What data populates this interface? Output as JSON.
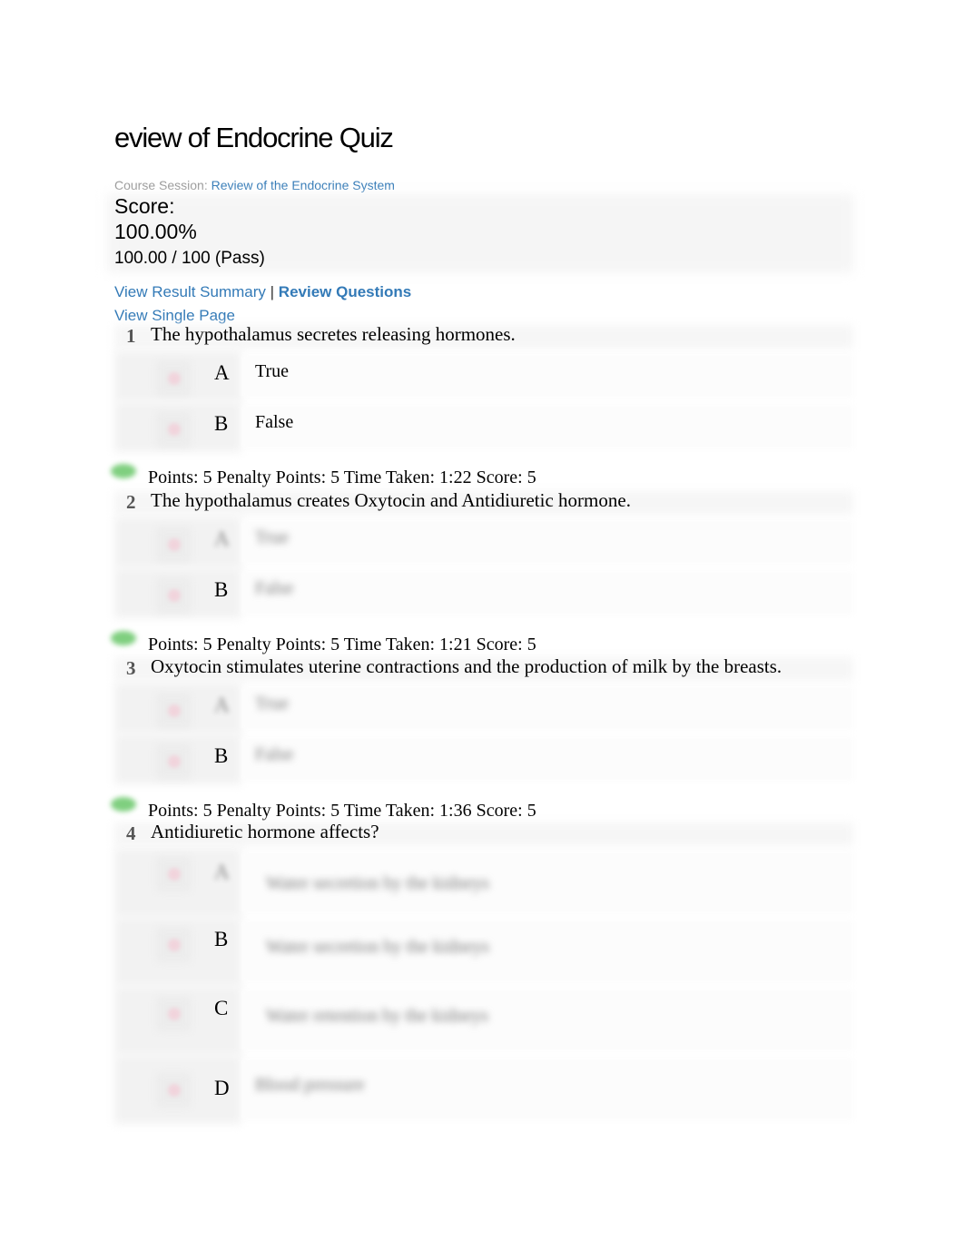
{
  "page": {
    "title": "eview of Endocrine Quiz",
    "course_session_label": "Course Session:",
    "course_session_link": "Review of the Endocrine System"
  },
  "score": {
    "label": "Score:",
    "percent": "100.00%",
    "detail": "100.00 / 100 (Pass)"
  },
  "nav": {
    "view_result_summary": "View Result Summary",
    "separator": "|",
    "review_questions": "Review Questions",
    "view_single_page": "View Single Page"
  },
  "colors": {
    "link": "#337ab7",
    "correct": "#7fcf7f"
  },
  "questions": [
    {
      "number": "1",
      "text": "The hypothalamus secretes releasing hormones.",
      "options": [
        {
          "letter": "A",
          "text": "True"
        },
        {
          "letter": "B",
          "text": "False"
        }
      ],
      "result": "Points: 5 Penalty Points: 5 Time Taken: 1:22 Score: 5",
      "status_icon": "check-icon"
    },
    {
      "number": "2",
      "text": "The hypothalamus creates Oxytocin and Antidiuretic hormone.",
      "options": [
        {
          "letter": "A",
          "text": "True"
        },
        {
          "letter": "B",
          "text": "False"
        }
      ],
      "result": "Points: 5 Penalty Points: 5 Time Taken: 1:21 Score: 5",
      "status_icon": "check-icon"
    },
    {
      "number": "3",
      "text": "Oxytocin stimulates uterine contractions and the production of milk by the breasts.",
      "options": [
        {
          "letter": "A",
          "text": "True"
        },
        {
          "letter": "B",
          "text": "False"
        }
      ],
      "result": "Points: 5 Penalty Points: 5 Time Taken: 1:36 Score: 5",
      "status_icon": "check-icon"
    },
    {
      "number": "4",
      "text": "Antidiuretic hormone affects?",
      "options": [
        {
          "letter": "A",
          "text": "Water secretion by the kidneys"
        },
        {
          "letter": "B",
          "text": "Water secretion by the kidneys"
        },
        {
          "letter": "C",
          "text": "Water retention by the kidneys"
        },
        {
          "letter": "D",
          "text": "Blood pressure"
        }
      ]
    }
  ]
}
